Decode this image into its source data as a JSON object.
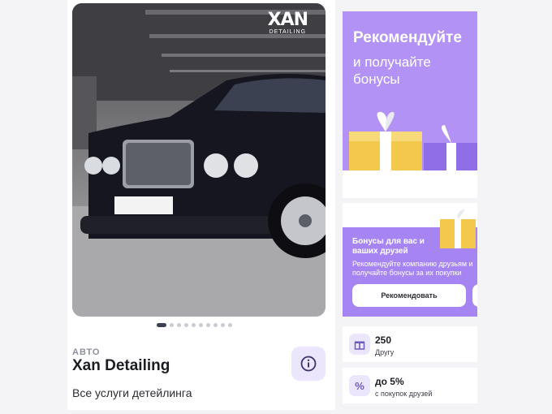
{
  "product": {
    "brand_mark": "XAN",
    "brand_sub": "DETAILING",
    "category": "АВТО",
    "name": "Xan Detailing",
    "tagline": "Все услуги детейлинга",
    "gallery_count": 10,
    "gallery_active": 1
  },
  "referral_banner": {
    "headline": "Рекомендуйте",
    "subline": "и получайте бонусы"
  },
  "bonus_card": {
    "title": "Бонусы для вас и ваших друзей",
    "description": "Рекомендуйте компанию друзьям и получайте бонусы за их покупки",
    "button_label": "Рекомендовать"
  },
  "stats": [
    {
      "icon": "gift-icon",
      "value": "250",
      "label": "Другу"
    },
    {
      "icon": "percent-icon",
      "value": "до 5%",
      "label": "с покупок друзей"
    }
  ],
  "colors": {
    "promo_purple": "#b392f5",
    "accent_light": "#ebe6fb",
    "gift_yellow": "#f2c94c"
  }
}
